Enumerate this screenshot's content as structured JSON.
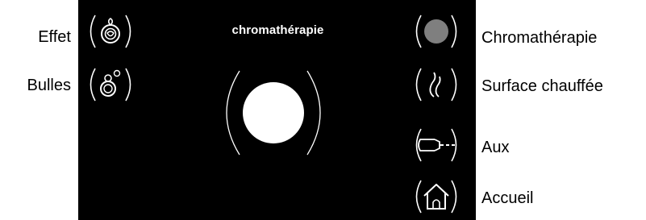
{
  "left_labels": {
    "effet": "Effet",
    "bulles": "Bulles"
  },
  "right_labels": {
    "chromatherapie": "Chromathérapie",
    "surface": "Surface chauffée",
    "aux": "Aux",
    "accueil": "Accueil"
  },
  "screen": {
    "title": "chromathérapie"
  },
  "icons": {
    "effet": "effect-drop-icon",
    "bulles": "bubbles-icon",
    "chromatherapie": "color-dot-icon",
    "surface": "heat-flame-icon",
    "aux": "aux-plug-icon",
    "accueil": "home-icon",
    "main": "color-circle-icon"
  },
  "colors": {
    "screen_bg": "#000000",
    "foreground": "#ffffff",
    "dot": "#7f7f7f"
  }
}
